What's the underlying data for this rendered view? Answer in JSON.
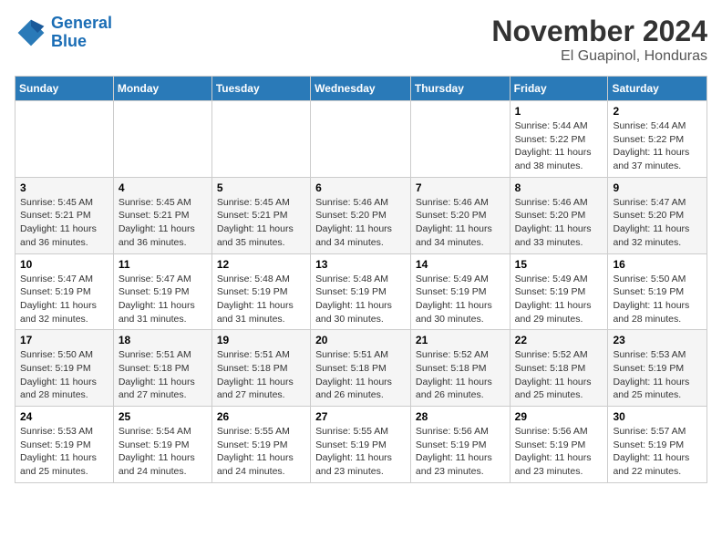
{
  "header": {
    "logo_line1": "General",
    "logo_line2": "Blue",
    "month": "November 2024",
    "location": "El Guapinol, Honduras"
  },
  "weekdays": [
    "Sunday",
    "Monday",
    "Tuesday",
    "Wednesday",
    "Thursday",
    "Friday",
    "Saturday"
  ],
  "weeks": [
    [
      {
        "day": "",
        "info": ""
      },
      {
        "day": "",
        "info": ""
      },
      {
        "day": "",
        "info": ""
      },
      {
        "day": "",
        "info": ""
      },
      {
        "day": "",
        "info": ""
      },
      {
        "day": "1",
        "info": "Sunrise: 5:44 AM\nSunset: 5:22 PM\nDaylight: 11 hours and 38 minutes."
      },
      {
        "day": "2",
        "info": "Sunrise: 5:44 AM\nSunset: 5:22 PM\nDaylight: 11 hours and 37 minutes."
      }
    ],
    [
      {
        "day": "3",
        "info": "Sunrise: 5:45 AM\nSunset: 5:21 PM\nDaylight: 11 hours and 36 minutes."
      },
      {
        "day": "4",
        "info": "Sunrise: 5:45 AM\nSunset: 5:21 PM\nDaylight: 11 hours and 36 minutes."
      },
      {
        "day": "5",
        "info": "Sunrise: 5:45 AM\nSunset: 5:21 PM\nDaylight: 11 hours and 35 minutes."
      },
      {
        "day": "6",
        "info": "Sunrise: 5:46 AM\nSunset: 5:20 PM\nDaylight: 11 hours and 34 minutes."
      },
      {
        "day": "7",
        "info": "Sunrise: 5:46 AM\nSunset: 5:20 PM\nDaylight: 11 hours and 34 minutes."
      },
      {
        "day": "8",
        "info": "Sunrise: 5:46 AM\nSunset: 5:20 PM\nDaylight: 11 hours and 33 minutes."
      },
      {
        "day": "9",
        "info": "Sunrise: 5:47 AM\nSunset: 5:20 PM\nDaylight: 11 hours and 32 minutes."
      }
    ],
    [
      {
        "day": "10",
        "info": "Sunrise: 5:47 AM\nSunset: 5:19 PM\nDaylight: 11 hours and 32 minutes."
      },
      {
        "day": "11",
        "info": "Sunrise: 5:47 AM\nSunset: 5:19 PM\nDaylight: 11 hours and 31 minutes."
      },
      {
        "day": "12",
        "info": "Sunrise: 5:48 AM\nSunset: 5:19 PM\nDaylight: 11 hours and 31 minutes."
      },
      {
        "day": "13",
        "info": "Sunrise: 5:48 AM\nSunset: 5:19 PM\nDaylight: 11 hours and 30 minutes."
      },
      {
        "day": "14",
        "info": "Sunrise: 5:49 AM\nSunset: 5:19 PM\nDaylight: 11 hours and 30 minutes."
      },
      {
        "day": "15",
        "info": "Sunrise: 5:49 AM\nSunset: 5:19 PM\nDaylight: 11 hours and 29 minutes."
      },
      {
        "day": "16",
        "info": "Sunrise: 5:50 AM\nSunset: 5:19 PM\nDaylight: 11 hours and 28 minutes."
      }
    ],
    [
      {
        "day": "17",
        "info": "Sunrise: 5:50 AM\nSunset: 5:19 PM\nDaylight: 11 hours and 28 minutes."
      },
      {
        "day": "18",
        "info": "Sunrise: 5:51 AM\nSunset: 5:18 PM\nDaylight: 11 hours and 27 minutes."
      },
      {
        "day": "19",
        "info": "Sunrise: 5:51 AM\nSunset: 5:18 PM\nDaylight: 11 hours and 27 minutes."
      },
      {
        "day": "20",
        "info": "Sunrise: 5:51 AM\nSunset: 5:18 PM\nDaylight: 11 hours and 26 minutes."
      },
      {
        "day": "21",
        "info": "Sunrise: 5:52 AM\nSunset: 5:18 PM\nDaylight: 11 hours and 26 minutes."
      },
      {
        "day": "22",
        "info": "Sunrise: 5:52 AM\nSunset: 5:18 PM\nDaylight: 11 hours and 25 minutes."
      },
      {
        "day": "23",
        "info": "Sunrise: 5:53 AM\nSunset: 5:19 PM\nDaylight: 11 hours and 25 minutes."
      }
    ],
    [
      {
        "day": "24",
        "info": "Sunrise: 5:53 AM\nSunset: 5:19 PM\nDaylight: 11 hours and 25 minutes."
      },
      {
        "day": "25",
        "info": "Sunrise: 5:54 AM\nSunset: 5:19 PM\nDaylight: 11 hours and 24 minutes."
      },
      {
        "day": "26",
        "info": "Sunrise: 5:55 AM\nSunset: 5:19 PM\nDaylight: 11 hours and 24 minutes."
      },
      {
        "day": "27",
        "info": "Sunrise: 5:55 AM\nSunset: 5:19 PM\nDaylight: 11 hours and 23 minutes."
      },
      {
        "day": "28",
        "info": "Sunrise: 5:56 AM\nSunset: 5:19 PM\nDaylight: 11 hours and 23 minutes."
      },
      {
        "day": "29",
        "info": "Sunrise: 5:56 AM\nSunset: 5:19 PM\nDaylight: 11 hours and 23 minutes."
      },
      {
        "day": "30",
        "info": "Sunrise: 5:57 AM\nSunset: 5:19 PM\nDaylight: 11 hours and 22 minutes."
      }
    ]
  ]
}
